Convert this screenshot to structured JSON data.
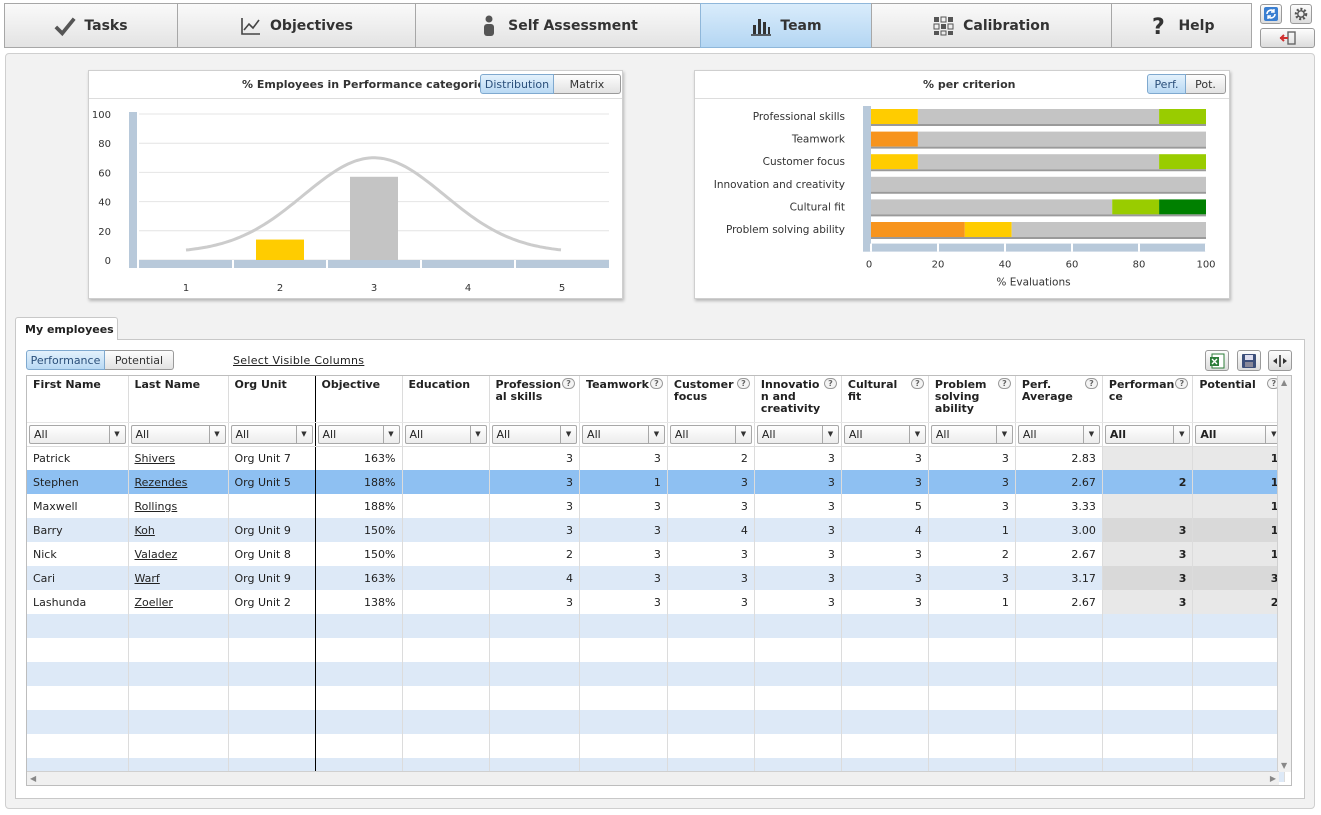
{
  "nav": {
    "tabs": [
      {
        "label": "Tasks",
        "icon": "check-icon",
        "active": false
      },
      {
        "label": "Objectives",
        "icon": "line-chart-icon",
        "active": false
      },
      {
        "label": "Self Assessment",
        "icon": "person-icon",
        "active": false
      },
      {
        "label": "Team",
        "icon": "bar-chart-icon",
        "active": true
      },
      {
        "label": "Calibration",
        "icon": "grid-icon",
        "active": false
      },
      {
        "label": "Help",
        "icon": "question-icon",
        "active": false
      }
    ],
    "corner_icons": [
      "refresh-icon",
      "gear-icon",
      "logout-icon"
    ]
  },
  "dist_chart": {
    "title": "% Employees in Performance categories",
    "toggle": [
      "Distribution",
      "Matrix"
    ],
    "active_toggle": "Distribution",
    "chart_data": {
      "type": "bar",
      "categories": [
        "1",
        "2",
        "3",
        "4",
        "5"
      ],
      "values": [
        0,
        14,
        57,
        0,
        0
      ],
      "bar_colors": [
        "#c4c4c4",
        "#ffcc00",
        "#c4c4c4",
        "#c4c4c4",
        "#c4c4c4"
      ],
      "ylim": [
        0,
        100
      ],
      "yticks": [
        0,
        20,
        40,
        60,
        80,
        100
      ],
      "overlay": "normal-distribution-curve",
      "grid": true
    }
  },
  "crit_chart": {
    "title": "% per criterion",
    "toggle": [
      "Perf.",
      "Pot."
    ],
    "active_toggle": "Perf.",
    "xlabel": "% Evaluations",
    "chart_data": {
      "type": "bar",
      "orientation": "horizontal",
      "stacked": true,
      "categories": [
        "Professional skills",
        "Teamwork",
        "Customer focus",
        "Innovation and creativity",
        "Cultural fit",
        "Problem solving ability"
      ],
      "series": [
        {
          "color": "#f7941d",
          "values": [
            0,
            14,
            0,
            0,
            0,
            28
          ]
        },
        {
          "color": "#ffcc00",
          "values": [
            14,
            0,
            14,
            0,
            0,
            14
          ]
        },
        {
          "color": "#c4c4c4",
          "values": [
            72,
            86,
            72,
            100,
            72,
            58
          ]
        },
        {
          "color": "#99cc00",
          "values": [
            14,
            0,
            14,
            0,
            14,
            0
          ]
        },
        {
          "color": "#008000",
          "values": [
            0,
            0,
            0,
            0,
            14,
            0
          ]
        }
      ],
      "xlim": [
        0,
        100
      ],
      "xticks": [
        0,
        20,
        40,
        60,
        80,
        100
      ]
    }
  },
  "employees": {
    "tab_label": "My employees",
    "view_toggle": [
      "Performance",
      "Potential"
    ],
    "active_view": "Performance",
    "select_columns": "Select Visible Columns",
    "toolbar_icons": [
      "excel-export-icon",
      "save-icon",
      "resize-columns-icon"
    ],
    "columns": [
      {
        "label": "First Name",
        "help": false
      },
      {
        "label": "Last Name",
        "help": false
      },
      {
        "label": "Org Unit",
        "help": false
      },
      {
        "label": "Objective",
        "help": false
      },
      {
        "label": "Education",
        "help": false
      },
      {
        "label": "Profession al skills",
        "help": true
      },
      {
        "label": "Teamwork",
        "help": true
      },
      {
        "label": "Customer focus",
        "help": true
      },
      {
        "label": "Innovatio n and creativity",
        "help": true
      },
      {
        "label": "Cultural fit",
        "help": true
      },
      {
        "label": "Problem solving ability",
        "help": true
      },
      {
        "label": "Perf. Average",
        "help": true
      },
      {
        "label": "Performan ce",
        "help": true
      },
      {
        "label": "Potential",
        "help": true
      }
    ],
    "filter_value": "All",
    "rows": [
      [
        "Patrick",
        "Shivers",
        "Org Unit 7",
        "163%",
        "",
        "3",
        "3",
        "2",
        "3",
        "3",
        "3",
        "2.83",
        "",
        "1"
      ],
      [
        "Stephen",
        "Rezendes",
        "Org Unit 5",
        "188%",
        "",
        "3",
        "1",
        "3",
        "3",
        "3",
        "3",
        "2.67",
        "2",
        "1"
      ],
      [
        "Maxwell",
        "Rollings",
        "",
        "188%",
        "",
        "3",
        "3",
        "3",
        "3",
        "5",
        "3",
        "3.33",
        "",
        "1"
      ],
      [
        "Barry",
        "Koh",
        "Org Unit 9",
        "150%",
        "",
        "3",
        "3",
        "4",
        "3",
        "4",
        "1",
        "3.00",
        "3",
        "1"
      ],
      [
        "Nick",
        "Valadez",
        "Org Unit 8",
        "150%",
        "",
        "2",
        "3",
        "3",
        "3",
        "3",
        "2",
        "2.67",
        "3",
        "1"
      ],
      [
        "Cari",
        "Warf",
        "Org Unit 9",
        "163%",
        "",
        "4",
        "3",
        "3",
        "3",
        "3",
        "3",
        "3.17",
        "3",
        "3"
      ],
      [
        "Lashunda",
        "Zoeller",
        "Org Unit 2",
        "138%",
        "",
        "3",
        "3",
        "3",
        "3",
        "3",
        "1",
        "2.67",
        "3",
        "2"
      ]
    ],
    "selected_row": 1,
    "empty_rows": 7
  }
}
